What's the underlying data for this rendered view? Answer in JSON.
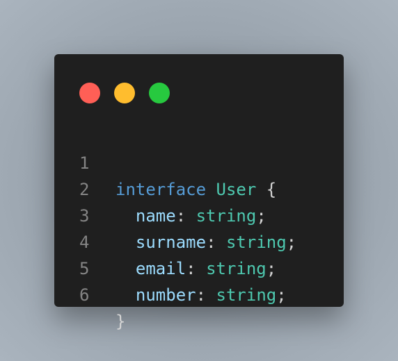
{
  "window": {
    "controls": [
      {
        "name": "close",
        "color": "#ff5f56"
      },
      {
        "name": "minimize",
        "color": "#ffbd2e"
      },
      {
        "name": "maximize",
        "color": "#27c93f"
      }
    ]
  },
  "code": {
    "line_numbers": [
      "1",
      "2",
      "3",
      "4",
      "5",
      "6"
    ],
    "line1": {
      "keyword": "interface",
      "type_name": "User",
      "brace": "{"
    },
    "line2": {
      "prop": "name",
      "colon": ":",
      "type": "string",
      "semi": ";"
    },
    "line3": {
      "prop": "surname",
      "colon": ":",
      "type": "string",
      "semi": ";"
    },
    "line4": {
      "prop": "email",
      "colon": ":",
      "type": "string",
      "semi": ";"
    },
    "line5": {
      "prop": "number",
      "colon": ":",
      "type": "string",
      "semi": ";"
    },
    "line6": {
      "brace": "}"
    }
  },
  "colors": {
    "keyword": "#569cd6",
    "type": "#4ec9b0",
    "property": "#9cdcfe",
    "punctuation": "#d4d4d4",
    "line_number": "#858585",
    "background": "#1f1f1f"
  }
}
